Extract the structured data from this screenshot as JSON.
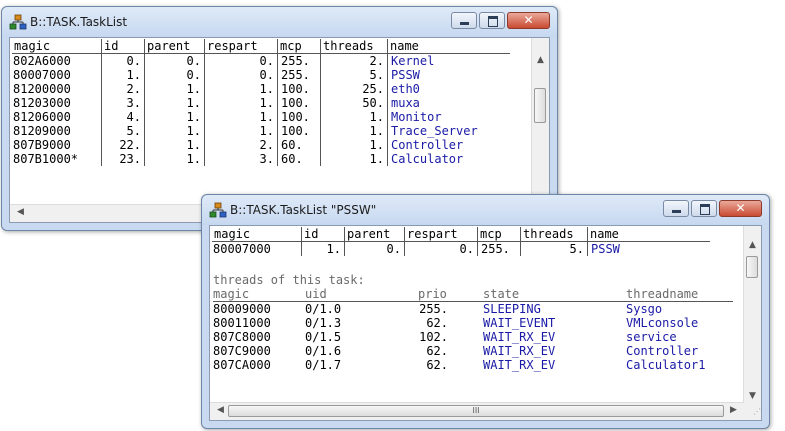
{
  "window1": {
    "title": "B::TASK.TaskList",
    "columns": [
      "magic",
      "id",
      "parent",
      "respart",
      "mcp",
      "threads",
      "name"
    ],
    "rows": [
      [
        "802A6000",
        "0.",
        "0.",
        "0.",
        "255.",
        "2.",
        "Kernel"
      ],
      [
        "80007000",
        "1.",
        "0.",
        "0.",
        "255.",
        "5.",
        "PSSW"
      ],
      [
        "81200000",
        "2.",
        "1.",
        "1.",
        "100.",
        "25.",
        "eth0"
      ],
      [
        "81203000",
        "3.",
        "1.",
        "1.",
        "100.",
        "50.",
        "muxa"
      ],
      [
        "81206000",
        "4.",
        "1.",
        "1.",
        "100.",
        "1.",
        "Monitor"
      ],
      [
        "81209000",
        "5.",
        "1.",
        "1.",
        "100.",
        "1.",
        "Trace_Server"
      ],
      [
        "807B9000",
        "22.",
        "1.",
        "2.",
        "60.",
        "1.",
        "Controller"
      ],
      [
        "807B1000*",
        "23.",
        "1.",
        "3.",
        "60.",
        "1.",
        "Calculator"
      ]
    ]
  },
  "window2": {
    "title": "B::TASK.TaskList \"PSSW\"",
    "columns": [
      "magic",
      "id",
      "parent",
      "respart",
      "mcp",
      "threads",
      "name"
    ],
    "row": [
      "80007000",
      "1.",
      "0.",
      "0.",
      "255.",
      "5.",
      "PSSW"
    ],
    "section_label": "threads of this task:",
    "thread_columns": [
      "magic",
      "uid",
      "prio",
      "state",
      "threadname"
    ],
    "threads": [
      [
        "80009000",
        "0/1.0",
        "255.",
        "SLEEPING",
        "Sysgo"
      ],
      [
        "80011000",
        "0/1.3",
        "62.",
        "WAIT_EVENT",
        "VMLconsole"
      ],
      [
        "807C8000",
        "0/1.5",
        "102.",
        "WAIT_RX_EV",
        "service"
      ],
      [
        "807C9000",
        "0/1.6",
        "62.",
        "WAIT_RX_EV",
        "Controller"
      ],
      [
        "807CA000",
        "0/1.7",
        "62.",
        "WAIT_RX_EV",
        "Calculator1"
      ]
    ],
    "hscroll_grip": "III"
  },
  "colors": {
    "name_text": "#1a1aa6",
    "header_gray": "#6a6a6a",
    "close_red": "#c94a31"
  },
  "icons": [
    "task-tree-icon",
    "minimize-icon",
    "maximize-icon",
    "close-icon",
    "scroll-up-icon",
    "scroll-down-icon",
    "scroll-left-icon",
    "scroll-right-icon",
    "size-grip-icon"
  ]
}
